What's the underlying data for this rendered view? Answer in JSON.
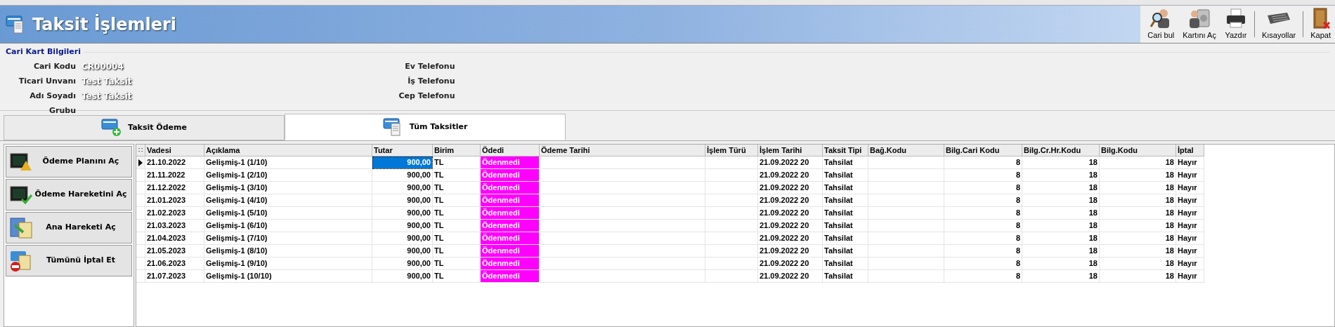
{
  "window": {
    "title": "Taksit İşlemleri"
  },
  "toolbar": [
    {
      "label": "Cari bul",
      "kind": "search"
    },
    {
      "label": "Kartını Aç",
      "kind": "card"
    },
    {
      "label": "Yazdır",
      "kind": "print"
    },
    {
      "kind": "separator"
    },
    {
      "label": "Kısayollar",
      "kind": "keyboard"
    },
    {
      "kind": "separator"
    },
    {
      "label": "Kapat",
      "kind": "close"
    }
  ],
  "info": {
    "title": "Cari Kart Bilgileri",
    "left": [
      {
        "label": "Cari Kodu",
        "value": "CR00004"
      },
      {
        "label": "Ticari Unvanı",
        "value": "Test Taksit"
      },
      {
        "label": "Adı Soyadı",
        "value": "Test Taksit"
      },
      {
        "label": "Grubu"
      }
    ],
    "right": [
      {
        "label": "Ev Telefonu"
      },
      {
        "label": "İş Telefonu"
      },
      {
        "label": "Cep Telefonu"
      }
    ]
  },
  "tabs": [
    {
      "label": "Taksit Ödeme",
      "selected": false,
      "kind": "payment"
    },
    {
      "label": "Tüm Taksitler",
      "selected": true,
      "kind": "list"
    }
  ],
  "actions": [
    {
      "label": "Ödeme Planını Aç",
      "kind": "plan"
    },
    {
      "label": "Ödeme Hareketini Aç",
      "kind": "check"
    },
    {
      "label": "Ana Hareketi Aç",
      "kind": "calc"
    },
    {
      "label": "Tümünü İptal Et",
      "kind": "cancel"
    }
  ],
  "table": {
    "corner": "∷",
    "columns": [
      "Vadesi",
      "Açıklama",
      "Tutar",
      "Birim",
      "Ödedi",
      "Ödeme Tarihi",
      "İşlem Türü",
      "İşlem Tarihi",
      "Taksit Tipi",
      "Bağ.Kodu",
      "Bilg.Cari Kodu",
      "Bilg.Cr.Hr.Kodu",
      "Bilg.Kodu",
      "İptal"
    ],
    "rows": [
      {
        "selected": true,
        "cells": [
          "21.10.2022",
          "Gelişmiş-1 (1/10)",
          "900,00",
          "TL",
          "Ödenmedi",
          "",
          "",
          "21.09.2022 20",
          "Tahsilat",
          "",
          "8",
          "18",
          "18",
          "Hayır"
        ]
      },
      {
        "selected": false,
        "cells": [
          "21.11.2022",
          "Gelişmiş-1 (2/10)",
          "900,00",
          "TL",
          "Ödenmedi",
          "",
          "",
          "21.09.2022 20",
          "Tahsilat",
          "",
          "8",
          "18",
          "18",
          "Hayır"
        ]
      },
      {
        "selected": false,
        "cells": [
          "21.12.2022",
          "Gelişmiş-1 (3/10)",
          "900,00",
          "TL",
          "Ödenmedi",
          "",
          "",
          "21.09.2022 20",
          "Tahsilat",
          "",
          "8",
          "18",
          "18",
          "Hayır"
        ]
      },
      {
        "selected": false,
        "cells": [
          "21.01.2023",
          "Gelişmiş-1 (4/10)",
          "900,00",
          "TL",
          "Ödenmedi",
          "",
          "",
          "21.09.2022 20",
          "Tahsilat",
          "",
          "8",
          "18",
          "18",
          "Hayır"
        ]
      },
      {
        "selected": false,
        "cells": [
          "21.02.2023",
          "Gelişmiş-1 (5/10)",
          "900,00",
          "TL",
          "Ödenmedi",
          "",
          "",
          "21.09.2022 20",
          "Tahsilat",
          "",
          "8",
          "18",
          "18",
          "Hayır"
        ]
      },
      {
        "selected": false,
        "cells": [
          "21.03.2023",
          "Gelişmiş-1 (6/10)",
          "900,00",
          "TL",
          "Ödenmedi",
          "",
          "",
          "21.09.2022 20",
          "Tahsilat",
          "",
          "8",
          "18",
          "18",
          "Hayır"
        ]
      },
      {
        "selected": false,
        "cells": [
          "21.04.2023",
          "Gelişmiş-1 (7/10)",
          "900,00",
          "TL",
          "Ödenmedi",
          "",
          "",
          "21.09.2022 20",
          "Tahsilat",
          "",
          "8",
          "18",
          "18",
          "Hayır"
        ]
      },
      {
        "selected": false,
        "cells": [
          "21.05.2023",
          "Gelişmiş-1 (8/10)",
          "900,00",
          "TL",
          "Ödenmedi",
          "",
          "",
          "21.09.2022 20",
          "Tahsilat",
          "",
          "8",
          "18",
          "18",
          "Hayır"
        ]
      },
      {
        "selected": false,
        "cells": [
          "21.06.2023",
          "Gelişmiş-1 (9/10)",
          "900,00",
          "TL",
          "Ödenmedi",
          "",
          "",
          "21.09.2022 20",
          "Tahsilat",
          "",
          "8",
          "18",
          "18",
          "Hayır"
        ]
      },
      {
        "selected": false,
        "cells": [
          "21.07.2023",
          "Gelişmiş-1 (10/10)",
          "900,00",
          "TL",
          "Ödenmedi",
          "",
          "",
          "21.09.2022 20",
          "Tahsilat",
          "",
          "8",
          "18",
          "18",
          "Hayır"
        ]
      }
    ]
  }
}
